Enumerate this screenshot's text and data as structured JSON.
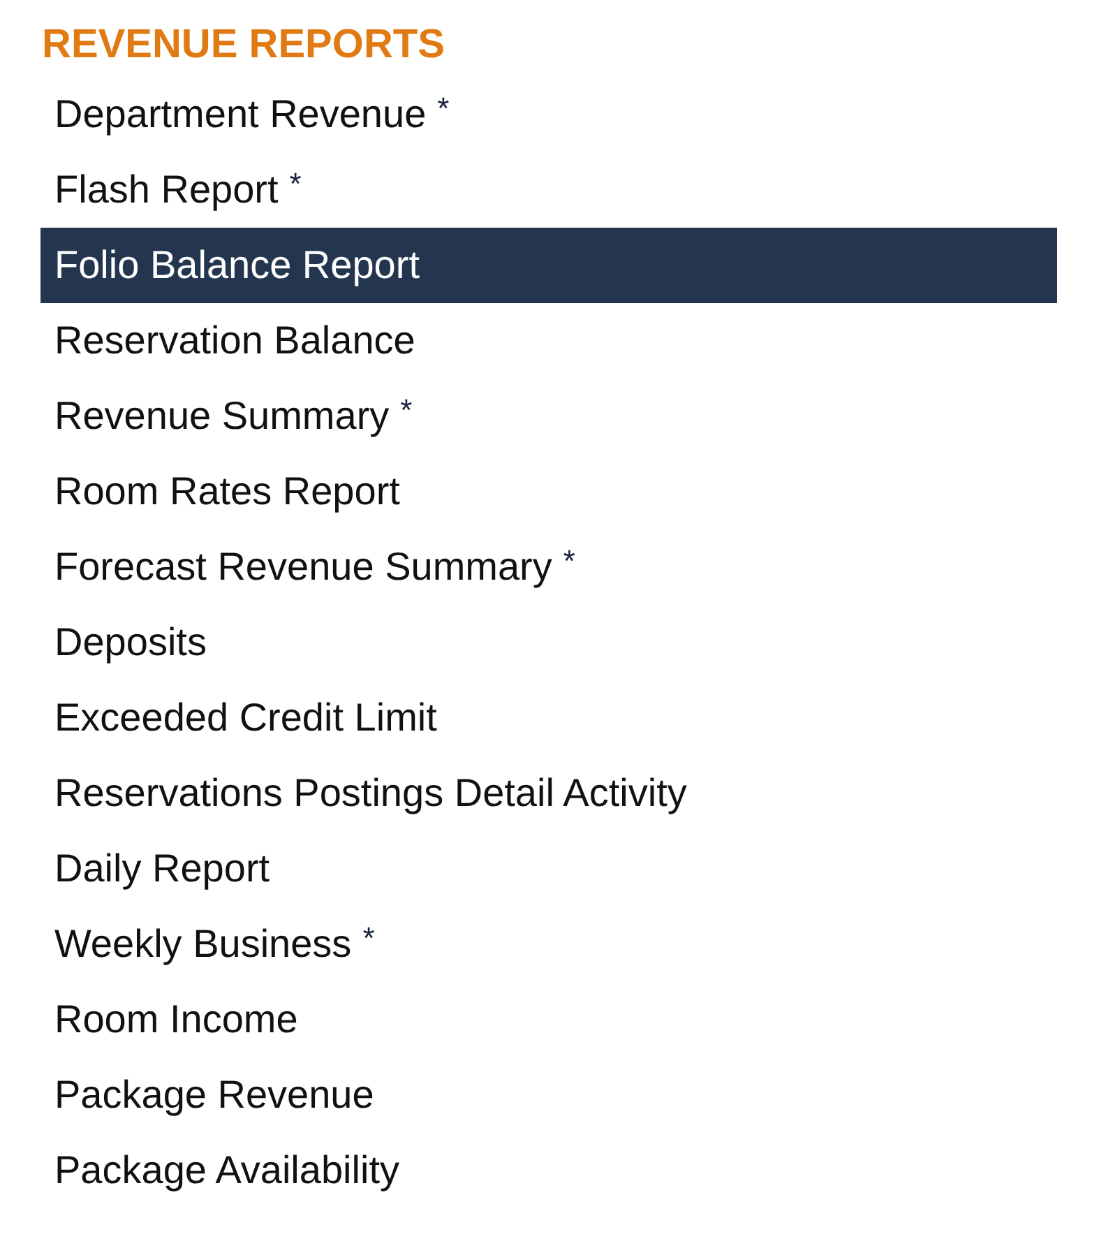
{
  "heading": "REVENUE REPORTS",
  "items": [
    {
      "label": "Department Revenue",
      "note": "*",
      "selected": false
    },
    {
      "label": "Flash Report",
      "note": "*",
      "selected": false
    },
    {
      "label": "Folio Balance Report",
      "selected": true
    },
    {
      "label": "Reservation Balance",
      "selected": false
    },
    {
      "label": "Revenue Summary",
      "note": "*",
      "selected": false
    },
    {
      "label": "Room Rates Report",
      "selected": false
    },
    {
      "label": "Forecast Revenue Summary",
      "note": "*",
      "selected": false
    },
    {
      "label": "Deposits",
      "selected": false
    },
    {
      "label": "Exceeded Credit Limit",
      "selected": false
    },
    {
      "label": "Reservations Postings Detail Activity",
      "selected": false
    },
    {
      "label": "Daily Report",
      "selected": false
    },
    {
      "label": "Weekly Business",
      "note": "*",
      "selected": false
    },
    {
      "label": "Room Income",
      "selected": false
    },
    {
      "label": "Package Revenue",
      "selected": false
    },
    {
      "label": "Package Availability",
      "selected": false
    }
  ]
}
